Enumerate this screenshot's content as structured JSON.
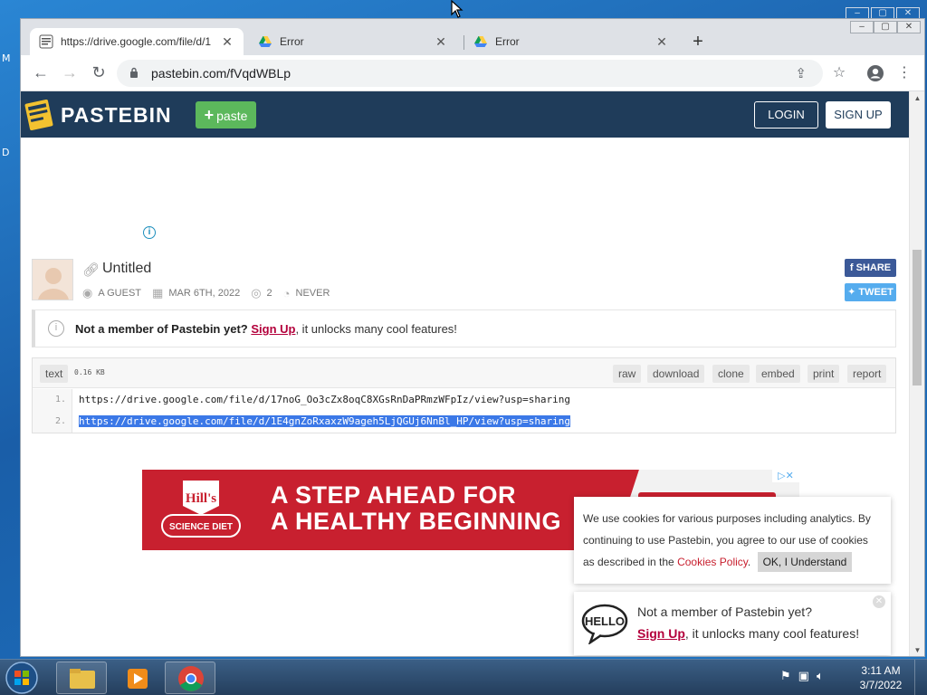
{
  "desktop": {
    "left_letters": [
      "M",
      "D"
    ],
    "bg_controls": [
      "–",
      "▢",
      "✕"
    ]
  },
  "browser": {
    "tabs": [
      {
        "title": "https://drive.google.com/file/d/1",
        "favicon": "pastebin-icon",
        "active": true
      },
      {
        "title": "Error",
        "favicon": "google-drive-icon",
        "active": false
      },
      {
        "title": "Error",
        "favicon": "google-drive-icon",
        "active": false
      }
    ],
    "new_tab": "+",
    "window_controls": [
      "–",
      "▢",
      "✕"
    ],
    "url": "pastebin.com/fVqdWBLp"
  },
  "pastebin": {
    "brand": "PASTEBIN",
    "paste_button": "paste",
    "login": "LOGIN",
    "signup": "SIGN UP",
    "paste": {
      "title": "Untitled",
      "author": "A GUEST",
      "date": "MAR 6TH, 2022",
      "views": "2",
      "expire": "NEVER"
    },
    "share": {
      "facebook": "SHARE",
      "twitter": "TWEET"
    },
    "notice": {
      "bold": "Not a member of Pastebin yet?",
      "link": "Sign Up",
      "rest": ", it unlocks many cool features!"
    },
    "code": {
      "syntax": "text",
      "size": "0.16 KB",
      "actions": [
        "raw",
        "download",
        "clone",
        "embed",
        "print",
        "report"
      ],
      "lines": [
        {
          "num": "1.",
          "text": "https://drive.google.com/file/d/17noG_Oo3cZx8oqC8XGsRnDaPRmzWFpIz/view?usp=sharing",
          "selected": false
        },
        {
          "num": "2.",
          "text": "https://drive.google.com/file/d/1E4gnZoRxaxzW9ageh5LjQGUj6NnBl_HP/view?usp=sharing",
          "selected": true
        }
      ]
    },
    "ad": {
      "brand_top": "Hill's",
      "brand_bottom": "SCIENCE DIET",
      "line1": "A STEP AHEAD FOR",
      "line2": "A HEALTHY BEGINNING"
    },
    "cookie": {
      "text": "We use cookies for various purposes including analytics. By continuing to use Pastebin, you agree to our use of cookies as described in the",
      "link": "Cookies Policy",
      "after": ".",
      "button": "OK, I Understand"
    },
    "promo": {
      "hello": "HELLO",
      "line1": "Not a member of Pastebin yet?",
      "link": "Sign Up",
      "rest": ", it unlocks many cool features!"
    }
  },
  "taskbar": {
    "time": "3:11 AM",
    "date": "3/7/2022"
  },
  "colors": {
    "pastebin_header": "#1f3c5a",
    "paste_green": "#5cb85c",
    "selection": "#3b78e7",
    "ad_red": "#c8202f"
  }
}
